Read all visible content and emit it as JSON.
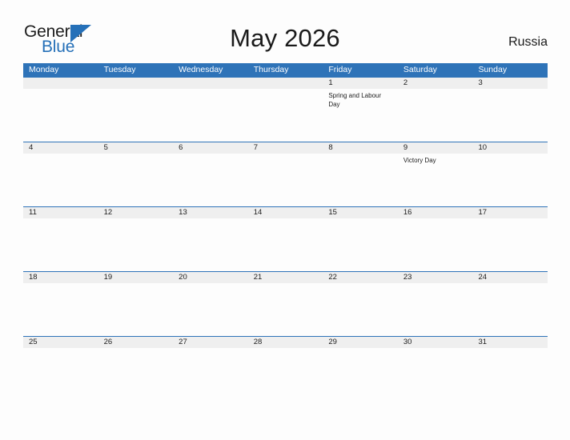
{
  "brand": {
    "name_part1": "General",
    "name_part2": "Blue",
    "accent_color": "#2570b8"
  },
  "header": {
    "title": "May 2026",
    "country": "Russia"
  },
  "colors": {
    "header_blue": "#2e73b8",
    "date_band_gray": "#efefef",
    "page_background": "#fdfdfd",
    "text": "#1c1c1c"
  },
  "calendar": {
    "weekdays": [
      "Monday",
      "Tuesday",
      "Wednesday",
      "Thursday",
      "Friday",
      "Saturday",
      "Sunday"
    ],
    "weeks": [
      [
        {
          "date": "",
          "event": ""
        },
        {
          "date": "",
          "event": ""
        },
        {
          "date": "",
          "event": ""
        },
        {
          "date": "",
          "event": ""
        },
        {
          "date": "1",
          "event": "Spring and Labour Day"
        },
        {
          "date": "2",
          "event": ""
        },
        {
          "date": "3",
          "event": ""
        }
      ],
      [
        {
          "date": "4",
          "event": ""
        },
        {
          "date": "5",
          "event": ""
        },
        {
          "date": "6",
          "event": ""
        },
        {
          "date": "7",
          "event": ""
        },
        {
          "date": "8",
          "event": ""
        },
        {
          "date": "9",
          "event": "Victory Day"
        },
        {
          "date": "10",
          "event": ""
        }
      ],
      [
        {
          "date": "11",
          "event": ""
        },
        {
          "date": "12",
          "event": ""
        },
        {
          "date": "13",
          "event": ""
        },
        {
          "date": "14",
          "event": ""
        },
        {
          "date": "15",
          "event": ""
        },
        {
          "date": "16",
          "event": ""
        },
        {
          "date": "17",
          "event": ""
        }
      ],
      [
        {
          "date": "18",
          "event": ""
        },
        {
          "date": "19",
          "event": ""
        },
        {
          "date": "20",
          "event": ""
        },
        {
          "date": "21",
          "event": ""
        },
        {
          "date": "22",
          "event": ""
        },
        {
          "date": "23",
          "event": ""
        },
        {
          "date": "24",
          "event": ""
        }
      ],
      [
        {
          "date": "25",
          "event": ""
        },
        {
          "date": "26",
          "event": ""
        },
        {
          "date": "27",
          "event": ""
        },
        {
          "date": "28",
          "event": ""
        },
        {
          "date": "29",
          "event": ""
        },
        {
          "date": "30",
          "event": ""
        },
        {
          "date": "31",
          "event": ""
        }
      ]
    ]
  }
}
